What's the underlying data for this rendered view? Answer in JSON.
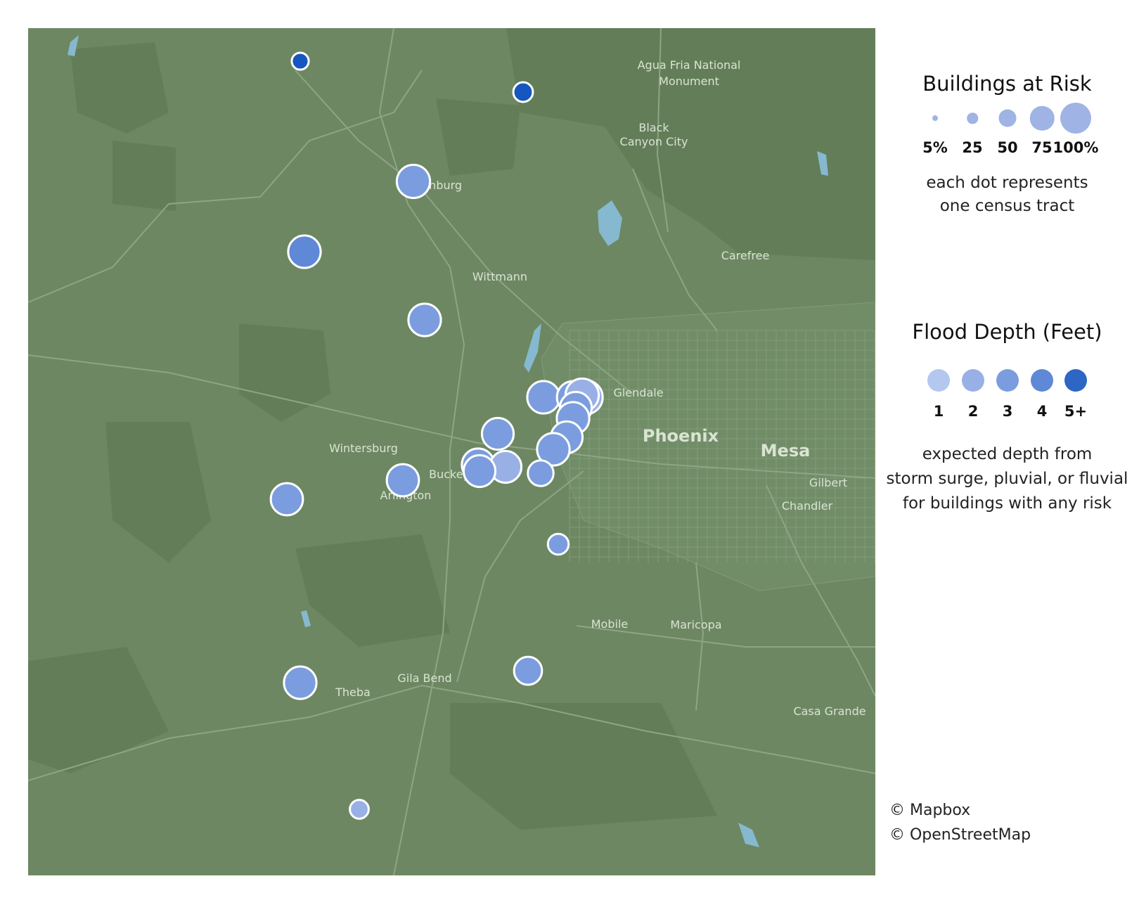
{
  "map": {
    "background_color": "#6d8762",
    "water_color": "#86b9cf",
    "point_colors": [
      "#b4c7ee",
      "#99b0e6",
      "#7b9ddf",
      "#5f88d6",
      "#1656bf"
    ],
    "place_labels": [
      {
        "text": "Agua Fria National",
        "major": false
      },
      {
        "text": "Monument",
        "major": false
      },
      {
        "text": "Black",
        "major": false
      },
      {
        "text": "Canyon City",
        "major": false
      },
      {
        "text": "Wickenburg",
        "major": false
      },
      {
        "text": "Carefree",
        "major": false
      },
      {
        "text": "Wittmann",
        "major": false
      },
      {
        "text": "Glendale",
        "major": false
      },
      {
        "text": "Phoenix",
        "major": true
      },
      {
        "text": "Mesa",
        "major": true
      },
      {
        "text": "Gilbert",
        "major": false
      },
      {
        "text": "Chandler",
        "major": false
      },
      {
        "text": "Wintersburg",
        "major": false
      },
      {
        "text": "Arlington",
        "major": false
      },
      {
        "text": "Buckeye",
        "major": false
      },
      {
        "text": "Mobile",
        "major": false
      },
      {
        "text": "Maricopa",
        "major": false
      },
      {
        "text": "Gila Bend",
        "major": false
      },
      {
        "text": "Theba",
        "major": false
      },
      {
        "text": "Casa Grande",
        "major": false
      }
    ],
    "census_tracts": [
      {
        "depth": 5,
        "risk_pct": 15
      },
      {
        "depth": 5,
        "risk_pct": 22
      },
      {
        "depth": 3,
        "risk_pct": 58
      },
      {
        "depth": 4,
        "risk_pct": 56
      },
      {
        "depth": 3,
        "risk_pct": 56
      },
      {
        "depth": 3,
        "risk_pct": 55
      },
      {
        "depth": 3,
        "risk_pct": 56
      },
      {
        "depth": 3,
        "risk_pct": 55
      },
      {
        "depth": 2,
        "risk_pct": 60
      },
      {
        "depth": 2,
        "risk_pct": 58
      },
      {
        "depth": 3,
        "risk_pct": 54
      },
      {
        "depth": 3,
        "risk_pct": 56
      },
      {
        "depth": 3,
        "risk_pct": 54
      },
      {
        "depth": 3,
        "risk_pct": 56
      },
      {
        "depth": 3,
        "risk_pct": 54
      },
      {
        "depth": 3,
        "risk_pct": 56
      },
      {
        "depth": 2,
        "risk_pct": 54
      },
      {
        "depth": 3,
        "risk_pct": 38
      },
      {
        "depth": 3,
        "risk_pct": 55
      },
      {
        "depth": 3,
        "risk_pct": 54
      },
      {
        "depth": 3,
        "risk_pct": 25
      },
      {
        "depth": 3,
        "risk_pct": 56
      },
      {
        "depth": 3,
        "risk_pct": 44
      },
      {
        "depth": 2,
        "risk_pct": 20
      }
    ]
  },
  "legend_size": {
    "title": "Buildings at Risk",
    "items": [
      {
        "label": "5%",
        "value": 5
      },
      {
        "label": "25",
        "value": 25
      },
      {
        "label": "50",
        "value": 50
      },
      {
        "label": "75",
        "value": 75
      },
      {
        "label": "100%",
        "value": 100
      }
    ],
    "note_line1": "each dot represents",
    "note_line2": "one census tract"
  },
  "legend_depth": {
    "title": "Flood Depth (Feet)",
    "items": [
      {
        "label": "1",
        "color": "#b4c7ee"
      },
      {
        "label": "2",
        "color": "#99b0e6"
      },
      {
        "label": "3",
        "color": "#7b9ddf"
      },
      {
        "label": "4",
        "color": "#5f88d6"
      },
      {
        "label": "5+",
        "color": "#2d66c4"
      }
    ],
    "note_line1": "expected depth from",
    "note_line2": "storm surge, pluvial, or fluvial",
    "note_line3": "for buildings with any risk"
  },
  "attribution": {
    "line1": "© Mapbox",
    "line2": "© OpenStreetMap"
  }
}
